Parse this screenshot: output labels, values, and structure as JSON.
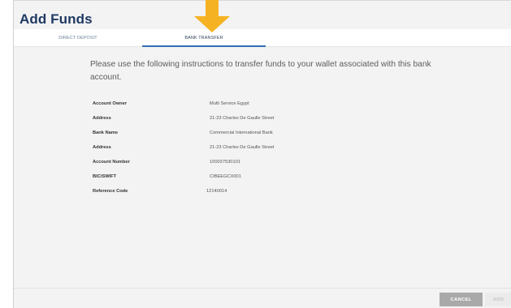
{
  "header": {
    "title": "Add Funds"
  },
  "tabs": [
    {
      "label": "DIRECT DEPOSIT"
    },
    {
      "label": "BANK TRANSFER"
    }
  ],
  "instructions": "Please use the following instructions to transfer funds to your wallet associated with this bank account.",
  "details": [
    {
      "label": "Account Owner",
      "value": "Multi Service Egypt"
    },
    {
      "label": "Address",
      "value": "21-23 Charles De Gaulle Street"
    },
    {
      "label": "Bank Name",
      "value": "Commercial International Bank"
    },
    {
      "label": "Address",
      "value": "21-23 Charles De Gaulle Street"
    },
    {
      "label": "Account Number",
      "value": "100037530101"
    },
    {
      "label": "BIC/SWIFT",
      "value": "CIBEEGCX001"
    },
    {
      "label": "Reference Code",
      "value": "12140014"
    }
  ],
  "footer": {
    "cancel_label": "CANCEL",
    "add_label": "ADD"
  },
  "colors": {
    "title": "#1e3a62",
    "active_tab": "#2e6fb7",
    "arrow": "#f5b323"
  },
  "icons": {
    "pointer": "arrow-down-icon"
  }
}
